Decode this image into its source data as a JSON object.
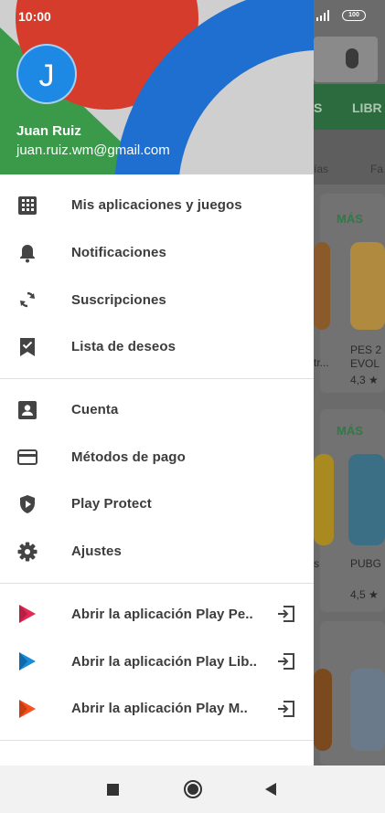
{
  "status_bar": {
    "time": "10:00",
    "battery": "100"
  },
  "profile": {
    "initial": "J",
    "name": "Juan Ruiz",
    "email": "juan.ruiz.wm@gmail.com"
  },
  "menu": {
    "group1": [
      {
        "label": "Mis aplicaciones y juegos",
        "icon": "apps-grid-icon"
      },
      {
        "label": "Notificaciones",
        "icon": "bell-icon"
      },
      {
        "label": "Suscripciones",
        "icon": "refresh-icon"
      },
      {
        "label": "Lista de deseos",
        "icon": "bookmark-check-icon"
      }
    ],
    "group2": [
      {
        "label": "Cuenta",
        "icon": "account-box-icon"
      },
      {
        "label": "Métodos de pago",
        "icon": "credit-card-icon"
      },
      {
        "label": "Play Protect",
        "icon": "shield-play-icon"
      },
      {
        "label": "Ajustes",
        "icon": "gear-icon"
      }
    ],
    "group3": [
      {
        "label": "Abrir la aplicación Play Pe..",
        "icon": "play-movies-icon",
        "trail_icon": "open-app-icon"
      },
      {
        "label": "Abrir la aplicación Play Lib..",
        "icon": "play-books-icon",
        "trail_icon": "open-app-icon"
      },
      {
        "label": "Abrir la aplicación Play M..",
        "icon": "play-music-icon",
        "trail_icon": "open-app-icon"
      }
    ]
  },
  "background": {
    "tabs": [
      "S",
      "LIBR"
    ],
    "categories": [
      "ías",
      "Fa"
    ],
    "more_label_1": "MÁS",
    "more_label_2": "MÁS",
    "card1_text_a": "tr...",
    "card1_text_b": "PES 2\nEVOL",
    "card1_rating": "4,3 ★",
    "card2_text_a": "s",
    "card2_text_b": "PUBG",
    "card2_rating": "4,5 ★"
  },
  "colors": {
    "accent_green": "#2f7b45",
    "avatar_blue": "#1e88e5"
  }
}
